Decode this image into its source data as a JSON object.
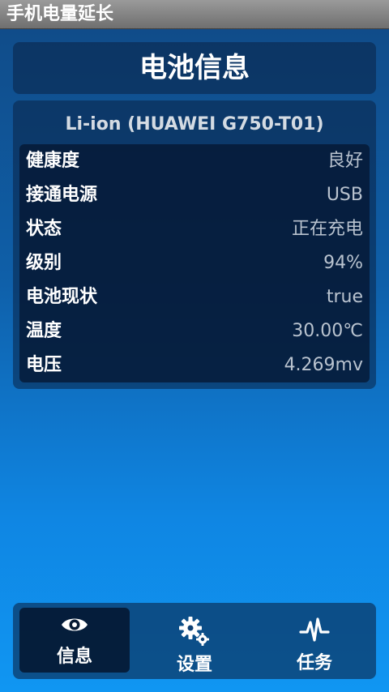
{
  "app": {
    "title": "手机电量延长"
  },
  "header": {
    "title": "电池信息"
  },
  "battery": {
    "device": "Li-ion (HUAWEI G750-T01)",
    "rows": [
      {
        "label": "健康度",
        "value": "良好"
      },
      {
        "label": "接通电源",
        "value": "USB"
      },
      {
        "label": "状态",
        "value": "正在充电"
      },
      {
        "label": "级别",
        "value": "94%"
      },
      {
        "label": "电池现状",
        "value": "true"
      },
      {
        "label": "温度",
        "value": "30.00℃"
      },
      {
        "label": "电压",
        "value": "4.269mv"
      }
    ]
  },
  "tabs": [
    {
      "label": "信息",
      "icon": "eye-icon",
      "active": true
    },
    {
      "label": "设置",
      "icon": "gears-icon",
      "active": false
    },
    {
      "label": "任务",
      "icon": "pulse-icon",
      "active": false
    }
  ],
  "colors": {
    "accent": "#0f86e3",
    "card": "#0a2346",
    "value_text": "#b9c3cf"
  }
}
